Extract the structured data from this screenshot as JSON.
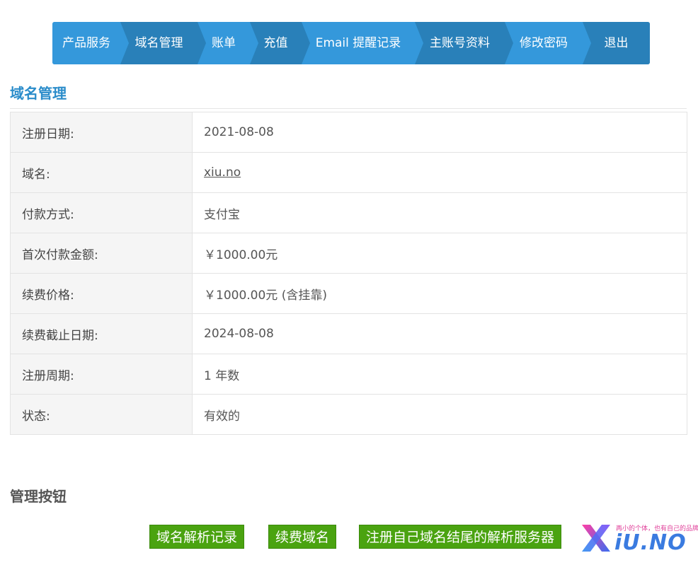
{
  "nav": {
    "items": [
      {
        "label": "产品服务"
      },
      {
        "label": "域名管理"
      },
      {
        "label": "账单"
      },
      {
        "label": "充值"
      },
      {
        "label": "Email 提醒记录"
      },
      {
        "label": "主账号资料"
      },
      {
        "label": "修改密码"
      },
      {
        "label": "退出"
      }
    ]
  },
  "section": {
    "title": "域名管理"
  },
  "details": {
    "rows": [
      {
        "label": "注册日期:",
        "value": "2021-08-08"
      },
      {
        "label": "域名:",
        "value": "xiu.no"
      },
      {
        "label": "付款方式:",
        "value": "支付宝"
      },
      {
        "label": "首次付款金额:",
        "value": "￥1000.00元"
      },
      {
        "label": "续费价格:",
        "value": "￥1000.00元 (含挂靠)"
      },
      {
        "label": "续费截止日期:",
        "value": "2024-08-08"
      },
      {
        "label": "注册周期:",
        "value": "1 年数"
      },
      {
        "label": "状态:",
        "value": "有效的"
      }
    ]
  },
  "manage": {
    "title": "管理按钮",
    "buttons": [
      {
        "label": "域名解析记录"
      },
      {
        "label": "续费域名"
      },
      {
        "label": "注册自己域名结尾的解析服务器"
      }
    ]
  },
  "logo": {
    "tagline": "再小的个体，也有自己的品牌",
    "wordmark": "iU.NO"
  },
  "colors": {
    "nav_primary": "#3498db",
    "nav_alt": "#2980b9",
    "title_accent": "#2a8cca",
    "button_green": "#4aa310"
  }
}
